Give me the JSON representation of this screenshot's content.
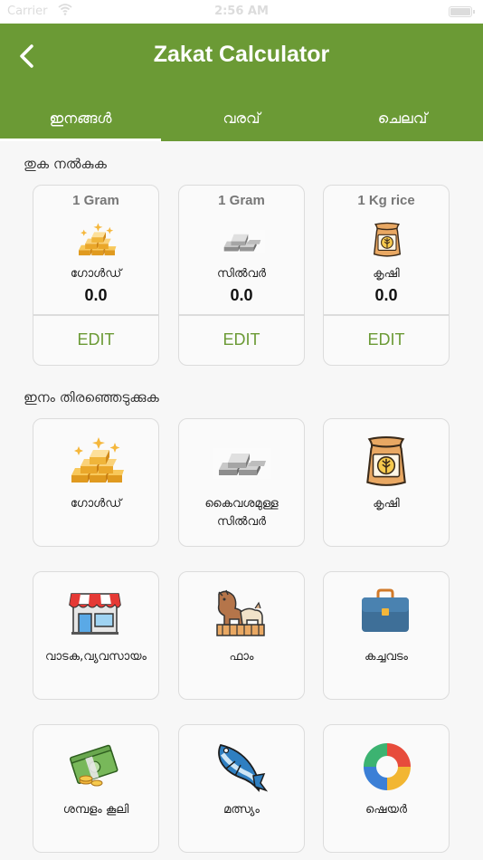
{
  "status_bar": {
    "carrier": "Carrier",
    "time": "2:56 AM",
    "wifi_icon": "wifi-icon",
    "battery_icon": "battery-icon"
  },
  "header": {
    "title": "Zakat Calculator",
    "back_icon": "back-arrow-icon"
  },
  "tabs": [
    {
      "label": "ഇനങ്ങൾ",
      "active": true
    },
    {
      "label": "വരവ്",
      "active": false
    },
    {
      "label": "ചെലവ്",
      "active": false
    }
  ],
  "rates_section": {
    "label": "തുക നൽകുക",
    "items": [
      {
        "unit": "1 Gram",
        "name": "ഗോൾഡ്",
        "value": "0.0",
        "edit_label": "EDIT",
        "icon": "gold-bars-icon"
      },
      {
        "unit": "1 Gram",
        "name": "സിൽവർ",
        "value": "0.0",
        "edit_label": "EDIT",
        "icon": "silver-bars-icon"
      },
      {
        "unit": "1 Kg rice",
        "name": "കൃഷി",
        "value": "0.0",
        "edit_label": "EDIT",
        "icon": "grain-sack-icon"
      }
    ]
  },
  "items_section": {
    "label": "ഇനം തിരഞ്ഞെടുക്കുക",
    "items": [
      {
        "name": "ഗോൾഡ്",
        "icon": "gold-bars-icon"
      },
      {
        "name": "കൈവശമുള്ള സിൽവർ",
        "icon": "silver-bars-icon"
      },
      {
        "name": "കൃഷി",
        "icon": "grain-sack-icon"
      },
      {
        "name": "വാടക,വ്യവസായം",
        "icon": "shop-icon"
      },
      {
        "name": "ഫാം",
        "icon": "farm-animals-icon"
      },
      {
        "name": "കച്ചവടം",
        "icon": "briefcase-icon"
      },
      {
        "name": "ശമ്പളം കൂലി",
        "icon": "cash-icon"
      },
      {
        "name": "മത്സ്യം",
        "icon": "fish-icon"
      },
      {
        "name": "ഷെയർ",
        "icon": "pie-chart-icon"
      }
    ]
  },
  "colors": {
    "primary": "#6b9a35",
    "card_border": "#dcdcdc",
    "background": "#f7f7f7"
  }
}
